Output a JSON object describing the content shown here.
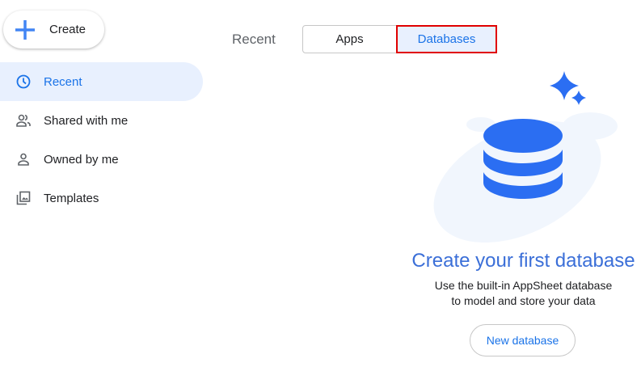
{
  "sidebar": {
    "create_label": "Create",
    "items": [
      {
        "label": "Recent",
        "icon": "clock-icon",
        "active": true
      },
      {
        "label": "Shared with me",
        "icon": "people-icon"
      },
      {
        "label": "Owned by me",
        "icon": "person-icon"
      },
      {
        "label": "Templates",
        "icon": "templates-icon"
      }
    ]
  },
  "main": {
    "recent_label": "Recent",
    "tabs": [
      {
        "label": "Apps"
      },
      {
        "label": "Databases",
        "selected": true
      }
    ],
    "empty_title": "Create your first database",
    "empty_line1": "Use the built-in AppSheet database",
    "empty_line2": "to model and store your data",
    "new_button": "New database"
  },
  "colors": {
    "accent": "#1a73e8",
    "db_blue": "#2b6ef2",
    "highlight": "#e00000"
  }
}
